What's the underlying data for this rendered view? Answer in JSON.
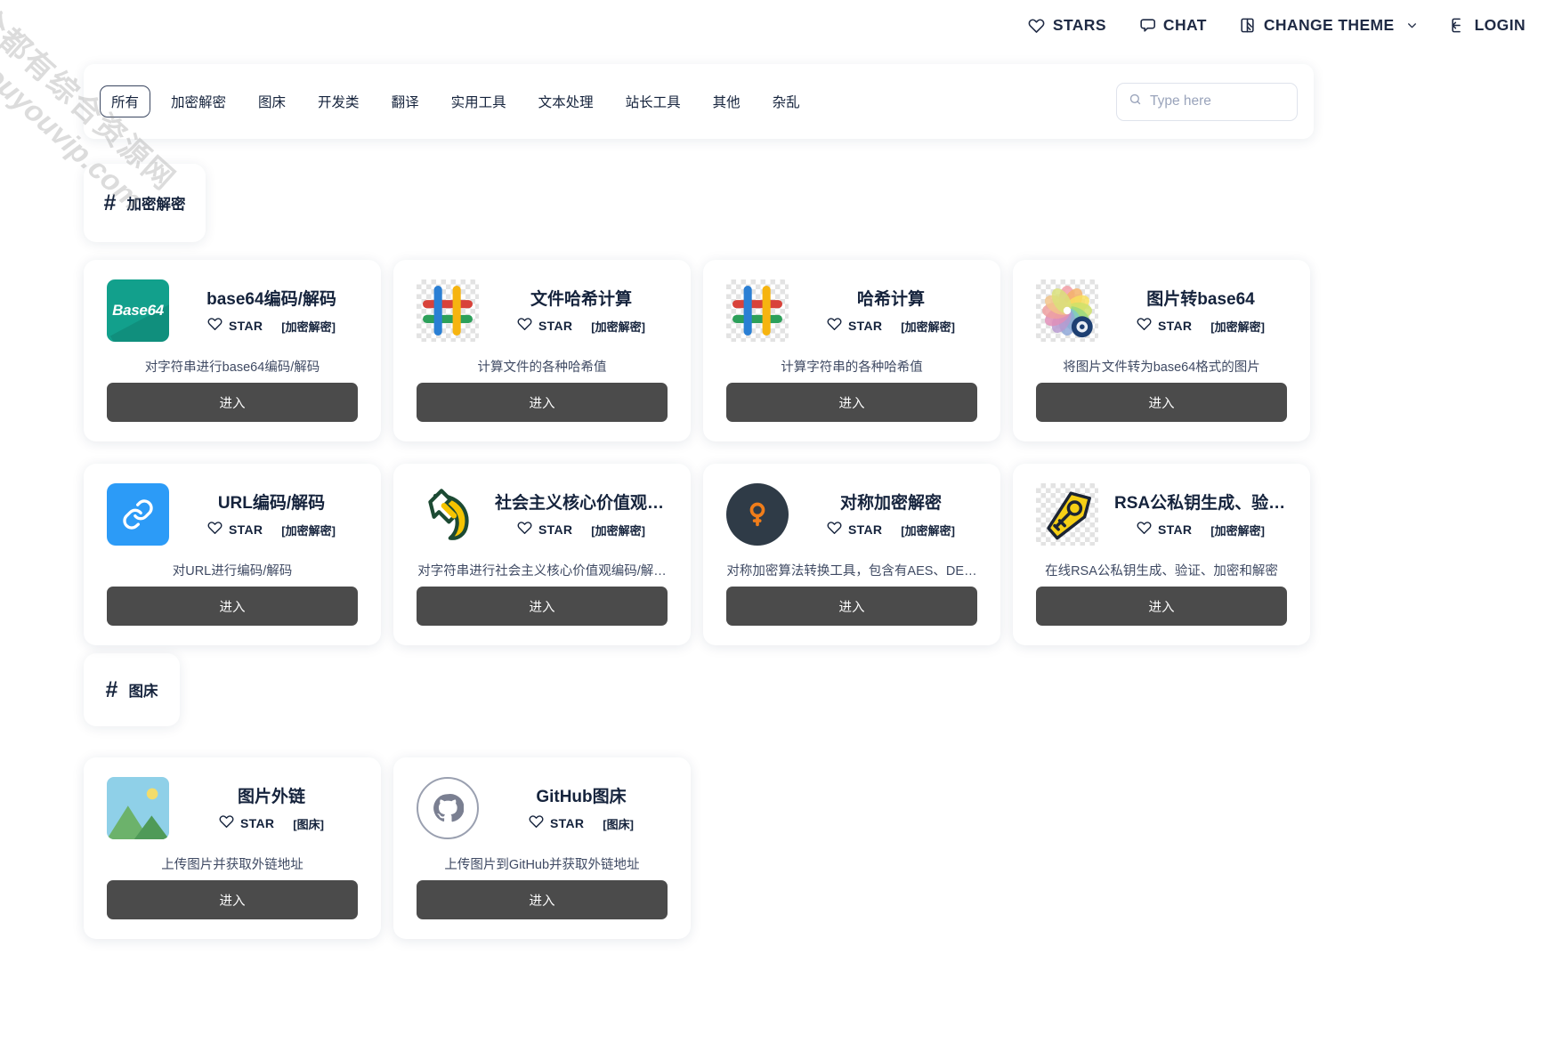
{
  "watermark": {
    "cn": "全都有综合资源网",
    "en": "douyouvip.com"
  },
  "topbar": {
    "items": [
      {
        "label": "STARS",
        "icon": "heart-icon"
      },
      {
        "label": "CHAT",
        "icon": "chat-icon"
      },
      {
        "label": "CHANGE THEME",
        "icon": "theme-icon",
        "caret": "⌄"
      },
      {
        "label": "LOGIN",
        "icon": "login-icon"
      }
    ]
  },
  "filter": {
    "tabs": [
      "所有",
      "加密解密",
      "图床",
      "开发类",
      "翻译",
      "实用工具",
      "文本处理",
      "站长工具",
      "其他",
      "杂乱"
    ],
    "active_index": 0,
    "search": {
      "placeholder": "Type here",
      "value": "",
      "icon": "search-icon"
    }
  },
  "sections": [
    {
      "hash": "#",
      "title": "加密解密"
    },
    {
      "hash": "#",
      "title": "图床"
    }
  ],
  "common": {
    "star_label": "STAR",
    "enter_label": "进入"
  },
  "cards": [
    {
      "title": "base64编码/解码",
      "star": "STAR",
      "category": "[加密解密]",
      "desc": "对字符串进行base64编码/解码",
      "enter": "进入",
      "icon": "base64-icon",
      "icon_text": "Base64",
      "icon_color": "#12a08c"
    },
    {
      "title": "文件哈希计算",
      "star": "STAR",
      "category": "[加密解密]",
      "desc": "计算文件的各种哈希值",
      "enter": "进入",
      "icon": "hash-icon",
      "icon_color": "#e8463a"
    },
    {
      "title": "哈希计算",
      "star": "STAR",
      "category": "[加密解密]",
      "desc": "计算字符串的各种哈希值",
      "enter": "进入",
      "icon": "hash-icon",
      "icon_color": "#e8463a"
    },
    {
      "title": "图片转base64",
      "star": "STAR",
      "category": "[加密解密]",
      "desc": "将图片文件转为base64格式的图片",
      "enter": "进入",
      "icon": "color-wheel-icon",
      "icon_color": "#1d3f72"
    },
    {
      "title": "URL编码/解码",
      "star": "STAR",
      "category": "[加密解密]",
      "desc": "对URL进行编码/解码",
      "enter": "进入",
      "icon": "link-icon",
      "icon_color": "#2c9bf7"
    },
    {
      "title": "社会主义核心价值观编…",
      "star": "STAR",
      "category": "[加密解密]",
      "desc": "对字符串进行社会主义核心价值观编码/解…",
      "enter": "进入",
      "icon": "hammer-sickle-icon",
      "icon_color": "#f5c400"
    },
    {
      "title": "对称加密解密",
      "star": "STAR",
      "category": "[加密解密]",
      "desc": "对称加密算法转换工具，包含有AES、DE…",
      "enter": "进入",
      "icon": "key-circle-icon",
      "icon_color": "#f07d1a"
    },
    {
      "title": "RSA公私钥生成、验证…",
      "star": "STAR",
      "category": "[加密解密]",
      "desc": "在线RSA公私钥生成、验证、加密和解密",
      "enter": "进入",
      "icon": "key-tag-icon",
      "icon_color": "#f5cf15"
    },
    {
      "title": "图片外链",
      "star": "STAR",
      "category": "[图床]",
      "desc": "上传图片并获取外链地址",
      "enter": "进入",
      "icon": "image-icon",
      "icon_color": "#8fd0e8"
    },
    {
      "title": "GitHub图床",
      "star": "STAR",
      "category": "[图床]",
      "desc": "上传图片到GitHub并获取外链地址",
      "enter": "进入",
      "icon": "github-icon",
      "icon_color": "#7a7f91"
    }
  ]
}
